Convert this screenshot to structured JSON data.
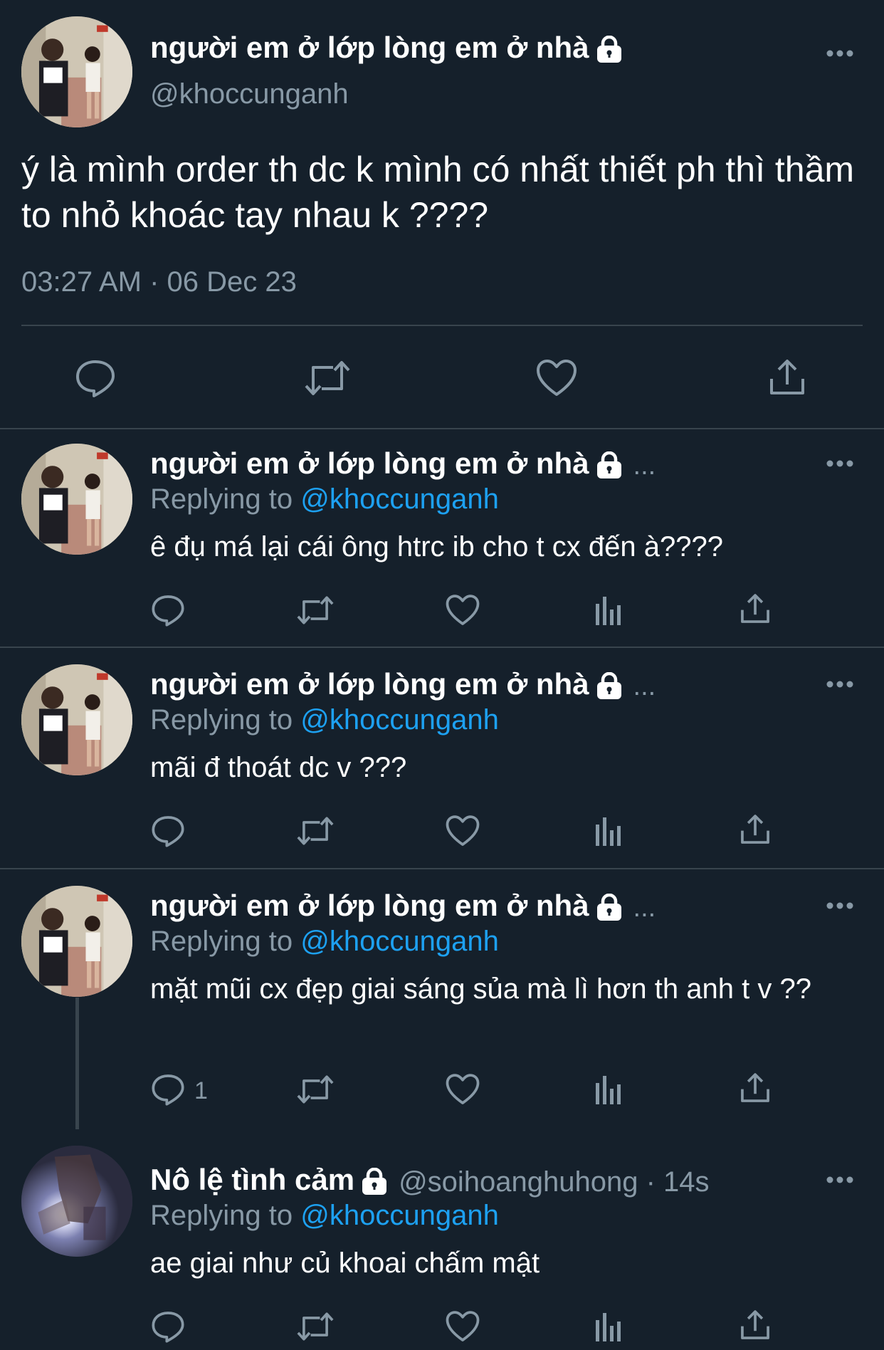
{
  "colors": {
    "background": "#15202b",
    "text": "#ffffff",
    "muted": "#8899a6",
    "link": "#1da1f2",
    "divider": "#38444d"
  },
  "main_tweet": {
    "display_name": "người em ở lớp lòng em ở nhà",
    "handle": "@khoccunganh",
    "text": "ý là mình order th dc k mình có nhất thiết ph thì thầm to nhỏ khoác tay nhau k ????",
    "timestamp": "03:27 AM · 06 Dec 23",
    "actions": [
      "reply-icon",
      "retweet-icon",
      "like-icon",
      "share-icon"
    ]
  },
  "replies": [
    {
      "display_name": "người em ở lớp lòng em ở nhà",
      "trail": "...",
      "replying_label": "Replying to",
      "replying_handle": "@khoccunganh",
      "text": "ê đụ má lại cái ông htrc ib cho t cx đến à????",
      "reply_count": ""
    },
    {
      "display_name": "người em ở lớp lòng em ở nhà",
      "trail": "...",
      "replying_label": "Replying to",
      "replying_handle": "@khoccunganh",
      "text": "mãi đ thoát dc v ???",
      "reply_count": ""
    },
    {
      "display_name": "người em ở lớp lòng em ở nhà",
      "trail": "...",
      "replying_label": "Replying to",
      "replying_handle": "@khoccunganh",
      "text": "mặt mũi cx đẹp giai sáng sủa mà lì hơn th anh t v ??",
      "reply_count": "1"
    },
    {
      "display_name": "Nô lệ tình cảm",
      "trail": "@soihoanghuhong · 14s",
      "replying_label": "Replying to",
      "replying_handle": "@khoccunganh",
      "text": "ae giai như củ khoai chấm mật",
      "reply_count": ""
    }
  ]
}
